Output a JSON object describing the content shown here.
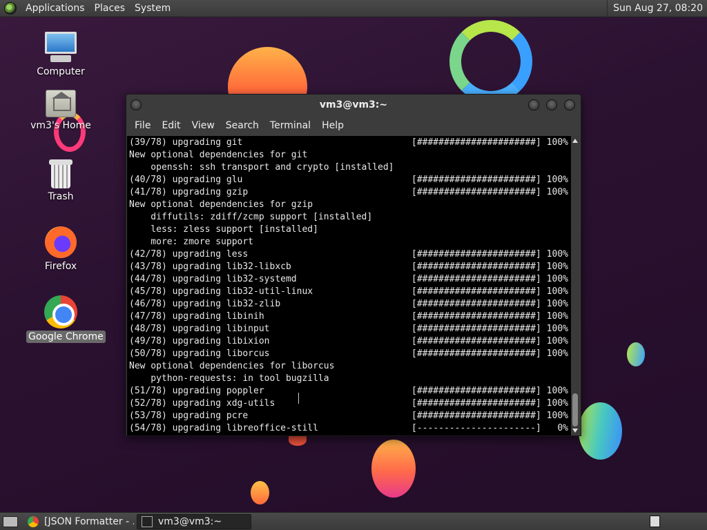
{
  "top_panel": {
    "menus": [
      "Applications",
      "Places",
      "System"
    ],
    "clock": "Sun Aug 27, 08:20"
  },
  "desktop_icons": [
    {
      "label": "Computer",
      "icon": "computer-icon"
    },
    {
      "label": "vm3's Home",
      "icon": "home-folder-icon"
    },
    {
      "label": "Trash",
      "icon": "trash-icon"
    },
    {
      "label": "Firefox",
      "icon": "firefox-icon"
    },
    {
      "label": "Google Chrome",
      "icon": "chrome-icon",
      "selected": true
    }
  ],
  "terminal": {
    "title": "vm3@vm3:~",
    "menus": [
      "File",
      "Edit",
      "View",
      "Search",
      "Terminal",
      "Help"
    ],
    "lines": [
      {
        "text": "(39/78) upgrading git",
        "bar": "[######################] 100%"
      },
      {
        "text": "New optional dependencies for git",
        "bar": ""
      },
      {
        "text": "    openssh: ssh transport and crypto [installed]",
        "bar": ""
      },
      {
        "text": "(40/78) upgrading glu",
        "bar": "[######################] 100%"
      },
      {
        "text": "(41/78) upgrading gzip",
        "bar": "[######################] 100%"
      },
      {
        "text": "New optional dependencies for gzip",
        "bar": ""
      },
      {
        "text": "    diffutils: zdiff/zcmp support [installed]",
        "bar": ""
      },
      {
        "text": "    less: zless support [installed]",
        "bar": ""
      },
      {
        "text": "    more: zmore support",
        "bar": ""
      },
      {
        "text": "(42/78) upgrading less",
        "bar": "[######################] 100%"
      },
      {
        "text": "(43/78) upgrading lib32-libxcb",
        "bar": "[######################] 100%"
      },
      {
        "text": "(44/78) upgrading lib32-systemd",
        "bar": "[######################] 100%"
      },
      {
        "text": "(45/78) upgrading lib32-util-linux",
        "bar": "[######################] 100%"
      },
      {
        "text": "(46/78) upgrading lib32-zlib",
        "bar": "[######################] 100%"
      },
      {
        "text": "(47/78) upgrading libinih",
        "bar": "[######################] 100%"
      },
      {
        "text": "(48/78) upgrading libinput",
        "bar": "[######################] 100%"
      },
      {
        "text": "(49/78) upgrading libixion",
        "bar": "[######################] 100%"
      },
      {
        "text": "(50/78) upgrading liborcus",
        "bar": "[######################] 100%"
      },
      {
        "text": "New optional dependencies for liborcus",
        "bar": ""
      },
      {
        "text": "    python-requests: in tool bugzilla",
        "bar": ""
      },
      {
        "text": "(51/78) upgrading poppler",
        "bar": "[######################] 100%"
      },
      {
        "text": "(52/78) upgrading xdg-utils",
        "bar": "[######################] 100%"
      },
      {
        "text": "(53/78) upgrading pcre",
        "bar": "[######################] 100%"
      },
      {
        "text": "(54/78) upgrading libreoffice-still",
        "bar": "[----------------------]   0%"
      }
    ]
  },
  "taskbar": {
    "tasks": [
      {
        "label": "[JSON Formatter - ...",
        "icon": "chrome-icon",
        "active": false
      },
      {
        "label": "vm3@vm3:~",
        "icon": "terminal-icon",
        "active": true
      }
    ]
  },
  "colors": {
    "desktop_bg": "#2a1130",
    "panel_bg": "#3f3f3f",
    "terminal_bg": "#000000",
    "terminal_fg": "#e8e8e8"
  }
}
